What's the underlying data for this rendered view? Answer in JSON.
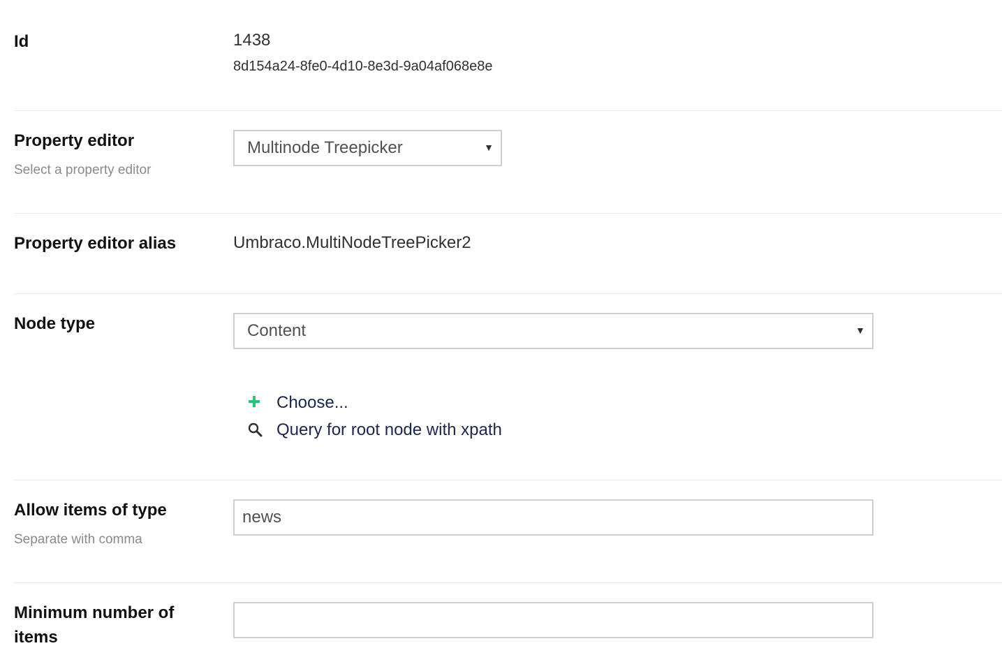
{
  "id_field": {
    "label": "Id",
    "number": "1438",
    "guid": "8d154a24-8fe0-4d10-8e3d-9a04af068e8e"
  },
  "property_editor": {
    "label": "Property editor",
    "description": "Select a property editor",
    "selected": "Multinode Treepicker"
  },
  "property_editor_alias": {
    "label": "Property editor alias",
    "value": "Umbraco.MultiNodeTreePicker2"
  },
  "node_type": {
    "label": "Node type",
    "selected": "Content",
    "choose_label": "Choose...",
    "query_label": "Query for root node with xpath",
    "choose_icon": "plus-icon",
    "query_icon": "search-icon",
    "accent_color": "#2bc37c"
  },
  "allow_items": {
    "label": "Allow items of type",
    "description": "Separate with comma",
    "value": "news"
  },
  "min_items": {
    "label": "Minimum number of items",
    "value": ""
  }
}
